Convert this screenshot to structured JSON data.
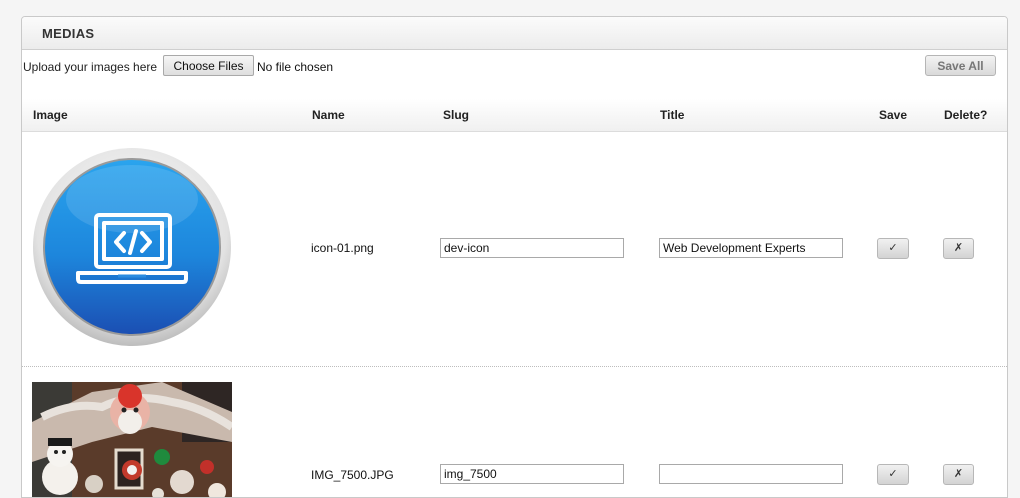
{
  "panel": {
    "title": "MEDIAS"
  },
  "upload": {
    "label": "Upload your images here",
    "choose_button": "Choose Files",
    "file_status": "No file chosen",
    "save_all": "Save All"
  },
  "table": {
    "headers": {
      "image": "Image",
      "name": "Name",
      "slug": "Slug",
      "title": "Title",
      "save": "Save",
      "delete": "Delete?"
    },
    "rows": [
      {
        "image_icon": "laptop-code-icon",
        "name": "icon-01.png",
        "slug": "dev-icon",
        "title": "Web Development Experts"
      },
      {
        "image_icon": "gingerbread-house-photo",
        "name": "IMG_7500.JPG",
        "slug": "img_7500",
        "title": ""
      }
    ],
    "save_glyph": "✓",
    "delete_glyph": "✗"
  },
  "colors": {
    "icon_blue": "#1f8fe0",
    "icon_blue_dark": "#1b53b5",
    "icon_ring": "#c8c8c8"
  }
}
